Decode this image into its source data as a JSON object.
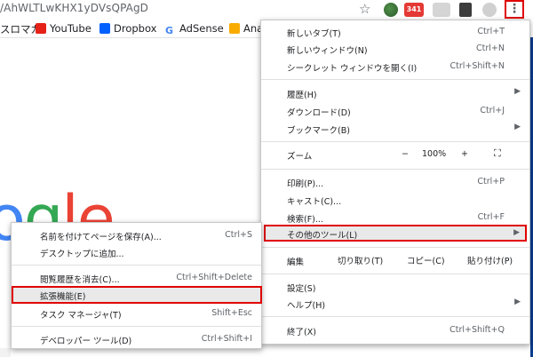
{
  "omnibox": {
    "url_fragment": "/AhWLTLwKHX1yDVsQPAgD"
  },
  "extensions": {
    "gmail_count": "341"
  },
  "bookmarks": [
    {
      "label": "スロマガ",
      "icon": "bookmark-icon",
      "color": "#ffffff"
    },
    {
      "label": "YouTube",
      "icon": "youtube-icon",
      "color": "#e62117"
    },
    {
      "label": "Dropbox",
      "icon": "dropbox-icon",
      "color": "#0061fe"
    },
    {
      "label": "AdSense",
      "icon": "google-icon",
      "color": "#4285f4"
    },
    {
      "label": "Ana",
      "icon": "analytics-icon",
      "color": "#f9ab00"
    }
  ],
  "logo_fragment": [
    "o",
    "g",
    "le"
  ],
  "main_menu": {
    "new_tab": {
      "label": "新しいタブ(T)",
      "shortcut": "Ctrl+T"
    },
    "new_window": {
      "label": "新しいウィンドウ(N)",
      "shortcut": "Ctrl+N"
    },
    "incognito": {
      "label": "シークレット ウィンドウを開く(I)",
      "shortcut": "Ctrl+Shift+N"
    },
    "history": {
      "label": "履歴(H)"
    },
    "downloads": {
      "label": "ダウンロード(D)",
      "shortcut": "Ctrl+J"
    },
    "bookmarks": {
      "label": "ブックマーク(B)"
    },
    "zoom": {
      "label": "ズーム",
      "minus": "−",
      "value": "100%",
      "plus": "+"
    },
    "print": {
      "label": "印刷(P)...",
      "shortcut": "Ctrl+P"
    },
    "cast": {
      "label": "キャスト(C)..."
    },
    "find": {
      "label": "検索(F)...",
      "shortcut": "Ctrl+F"
    },
    "more_tools": {
      "label": "その他のツール(L)"
    },
    "edit": {
      "label": "編集",
      "cut": "切り取り(T)",
      "copy": "コピー(C)",
      "paste": "貼り付け(P)"
    },
    "settings": {
      "label": "設定(S)"
    },
    "help": {
      "label": "ヘルプ(H)"
    },
    "exit": {
      "label": "終了(X)",
      "shortcut": "Ctrl+Shift+Q"
    }
  },
  "sub_menu": {
    "save_page": {
      "label": "名前を付けてページを保存(A)...",
      "shortcut": "Ctrl+S"
    },
    "add_to_desktop": {
      "label": "デスクトップに追加..."
    },
    "clear_data": {
      "label": "閲覧履歴を消去(C)...",
      "shortcut": "Ctrl+Shift+Delete"
    },
    "extensions": {
      "label": "拡張機能(E)"
    },
    "task_manager": {
      "label": "タスク マネージャ(T)",
      "shortcut": "Shift+Esc"
    },
    "dev_tools": {
      "label": "デベロッパー ツール(D)",
      "shortcut": "Ctrl+Shift+I"
    }
  },
  "colors": {
    "highlight_border": "#e00000",
    "hover_bg": "#e9e9e9"
  }
}
